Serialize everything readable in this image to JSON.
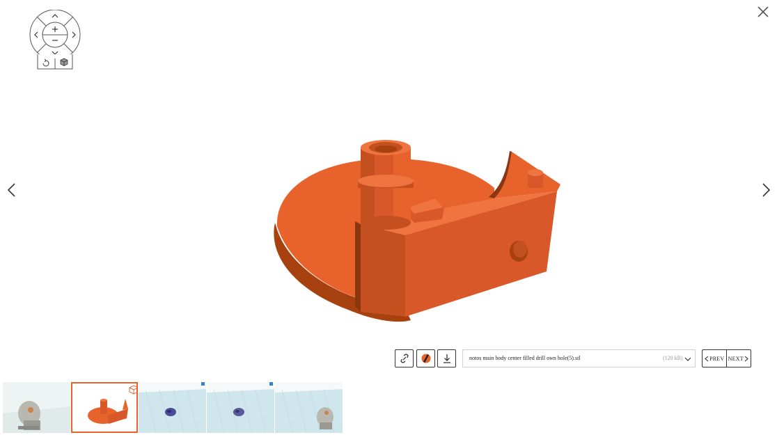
{
  "viewer": {
    "file_name": "notos main body center filled drill own hole(5).stl",
    "file_size": "(120 kB)",
    "prev_label": "PREV",
    "next_label": "NEXT",
    "model_color": "#e8622c"
  },
  "controls": {
    "icons": [
      "close-icon",
      "chevron-left-icon",
      "chevron-right-icon",
      "zoom-in-icon",
      "zoom-out-icon",
      "reset-view-icon",
      "cube-icon",
      "link-icon",
      "color-icon",
      "download-icon",
      "chevron-down-icon"
    ]
  },
  "thumbnails": [
    {
      "kind": "assembly-gray",
      "active": false
    },
    {
      "kind": "orange-part",
      "active": true
    },
    {
      "kind": "blue-part-slicer",
      "active": false
    },
    {
      "kind": "blue-part-slicer",
      "active": false
    },
    {
      "kind": "assembly-slicer",
      "active": false
    }
  ]
}
